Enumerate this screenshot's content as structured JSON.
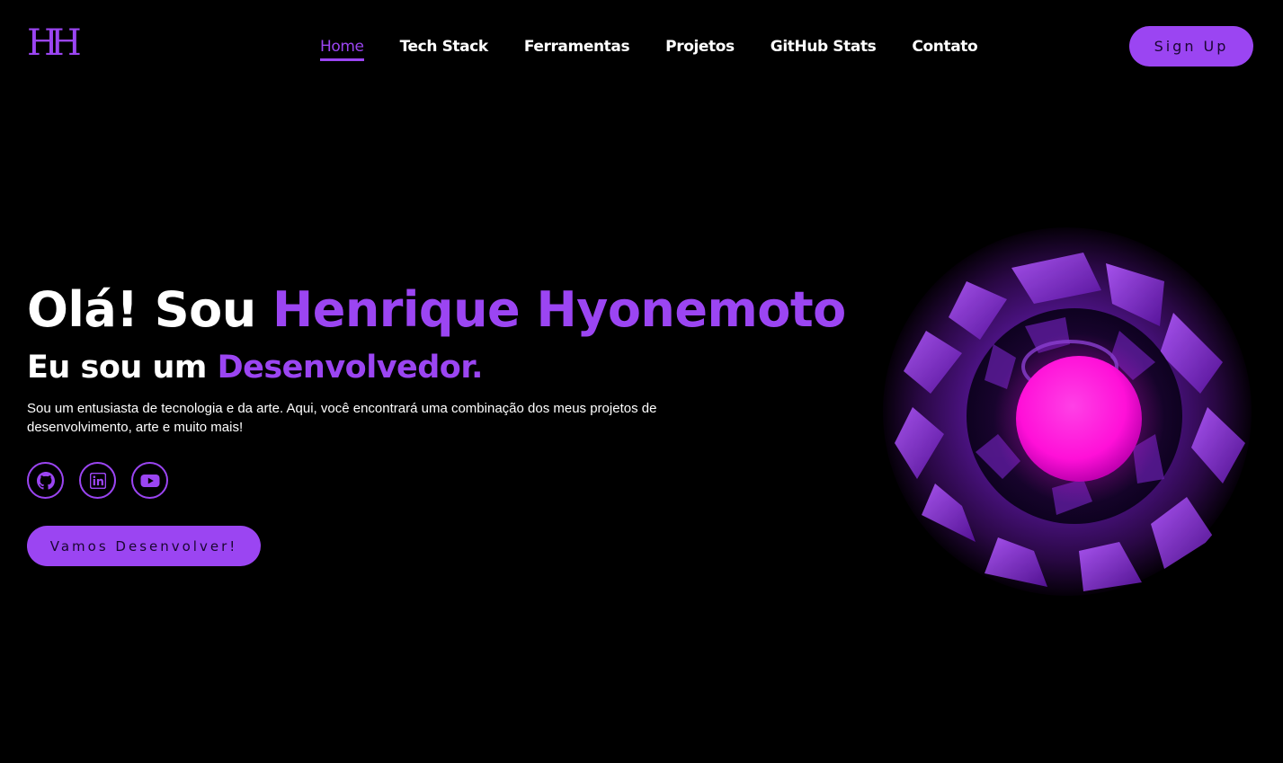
{
  "logo": {
    "text": "HH"
  },
  "nav": {
    "items": [
      {
        "label": "Home",
        "active": true
      },
      {
        "label": "Tech Stack",
        "active": false
      },
      {
        "label": "Ferramentas",
        "active": false
      },
      {
        "label": "Projetos",
        "active": false
      },
      {
        "label": "GitHub Stats",
        "active": false
      },
      {
        "label": "Contato",
        "active": false
      }
    ],
    "signup_label": "Sign Up"
  },
  "hero": {
    "greeting": "Olá! Sou ",
    "name": "Henrique Hyonemoto",
    "subtitle_prefix": "Eu sou um ",
    "subtitle_role": "Desenvolvedor.",
    "description": "Sou um entusiasta de tecnologia e da arte. Aqui, você encontrará uma combinação dos meus projetos de desenvolvimento, arte e muito mais!",
    "cta_label": "Vamos Desenvolver!",
    "socials": [
      {
        "icon": "github-icon"
      },
      {
        "icon": "linkedin-icon"
      },
      {
        "icon": "youtube-icon"
      }
    ]
  },
  "colors": {
    "background": "#000000",
    "accent": "#9b45f2",
    "text": "#ffffff",
    "orb": "#ff10d8"
  }
}
